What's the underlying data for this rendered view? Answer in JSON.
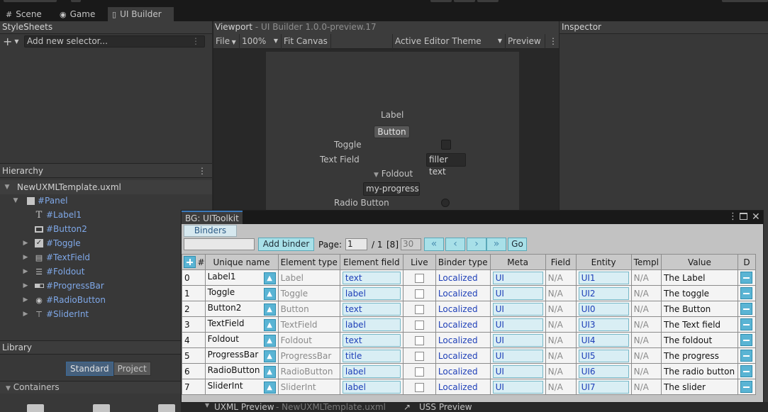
{
  "editor_tabs": [
    {
      "label": "Scene",
      "icon": "grid-icon"
    },
    {
      "label": "Game",
      "icon": "gamepad-icon"
    },
    {
      "label": "UI Builder",
      "icon": "builder-icon"
    }
  ],
  "stylesheets": {
    "title": "StyleSheets",
    "add_selector_placeholder": "Add new selector..."
  },
  "hierarchy": {
    "title": "Hierarchy",
    "root": "NewUXMLTemplate.uxml",
    "items": [
      {
        "label": "#Panel",
        "icon": "panel-icon"
      },
      {
        "label": "#Label1",
        "icon": "text-icon"
      },
      {
        "label": "#Button2",
        "icon": "button-icon"
      },
      {
        "label": "#Toggle",
        "icon": "toggle-icon"
      },
      {
        "label": "#TextField",
        "icon": "textfield-icon"
      },
      {
        "label": "#Foldout",
        "icon": "foldout-icon"
      },
      {
        "label": "#ProgressBar",
        "icon": "progressbar-icon"
      },
      {
        "label": "#RadioButton",
        "icon": "radio-icon"
      },
      {
        "label": "#SliderInt",
        "icon": "slider-icon"
      }
    ]
  },
  "library": {
    "title": "Library",
    "tabs": [
      "Standard",
      "Project"
    ],
    "section": "Containers"
  },
  "viewport": {
    "title": "Viewport",
    "subtitle": "- UI Builder 1.0.0-preview.17",
    "toolbar": {
      "file": "File",
      "zoom": "100%",
      "fit": "Fit Canvas",
      "theme": "Active Editor Theme",
      "preview": "Preview"
    },
    "canvas": {
      "label": "Label",
      "button": "Button",
      "toggle": "Toggle",
      "text_field": "Text Field",
      "text_field_value": "filler text",
      "foldout": "Foldout",
      "progress": "my-progress",
      "radio": "Radio Button"
    }
  },
  "inspector": {
    "title": "Inspector"
  },
  "bottom": {
    "uxml_preview": "UXML Preview",
    "uxml_sub": "- NewUXMLTemplate.uxml",
    "uss_preview": "USS Preview"
  },
  "bg_window": {
    "title": "BG: UIToolkit",
    "tab": "Binders",
    "add_binder": "Add binder",
    "page_label": "Page:",
    "page_value": "1",
    "page_total": "/ 1",
    "count": "[8]",
    "page_size": "30",
    "go": "Go",
    "columns": [
      "#",
      "Unique name",
      "Element type",
      "Element field",
      "Live",
      "Binder type",
      "Meta",
      "Field",
      "Entity",
      "Templ",
      "Value",
      "D"
    ],
    "rows": [
      {
        "idx": "0",
        "name": "Label1",
        "type": "Label",
        "field": "text",
        "binder": "Localized",
        "meta": "UI",
        "fld": "N/A",
        "entity": "UI1",
        "templ": "N/A",
        "value": "The Label"
      },
      {
        "idx": "1",
        "name": "Toggle",
        "type": "Toggle",
        "field": "label",
        "binder": "Localized",
        "meta": "UI",
        "fld": "N/A",
        "entity": "UI2",
        "templ": "N/A",
        "value": "The toggle"
      },
      {
        "idx": "2",
        "name": "Button2",
        "type": "Button",
        "field": "text",
        "binder": "Localized",
        "meta": "UI",
        "fld": "N/A",
        "entity": "UI0",
        "templ": "N/A",
        "value": "The Button"
      },
      {
        "idx": "3",
        "name": "TextField",
        "type": "TextField",
        "field": "label",
        "binder": "Localized",
        "meta": "UI",
        "fld": "N/A",
        "entity": "UI3",
        "templ": "N/A",
        "value": "The Text field"
      },
      {
        "idx": "4",
        "name": "Foldout",
        "type": "Foldout",
        "field": "text",
        "binder": "Localized",
        "meta": "UI",
        "fld": "N/A",
        "entity": "UI4",
        "templ": "N/A",
        "value": "The foldout"
      },
      {
        "idx": "5",
        "name": "ProgressBar",
        "type": "ProgressBar",
        "field": "title",
        "binder": "Localized",
        "meta": "UI",
        "fld": "N/A",
        "entity": "UI5",
        "templ": "N/A",
        "value": "The progress"
      },
      {
        "idx": "6",
        "name": "RadioButton",
        "type": "RadioButton",
        "field": "label",
        "binder": "Localized",
        "meta": "UI",
        "fld": "N/A",
        "entity": "UI6",
        "templ": "N/A",
        "value": "The radio button"
      },
      {
        "idx": "7",
        "name": "SliderInt",
        "type": "SliderInt",
        "field": "label",
        "binder": "Localized",
        "meta": "UI",
        "fld": "N/A",
        "entity": "UI7",
        "templ": "N/A",
        "value": "The slider"
      }
    ]
  }
}
